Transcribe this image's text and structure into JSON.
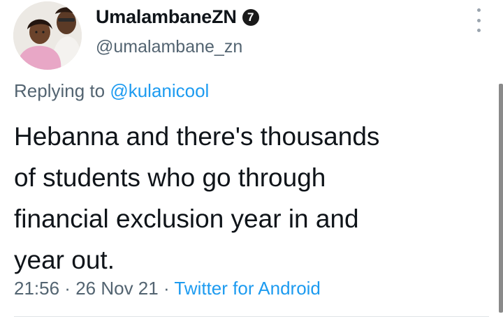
{
  "user": {
    "display_name": "UmalambaneZN",
    "badge": "7",
    "handle": "@umalambane_zn"
  },
  "reply": {
    "prefix": "Replying to ",
    "mention": "@kulanicool"
  },
  "tweet": {
    "text": "Hebanna and there's thousands\nof students who go through\nfinancial exclusion year in and\nyear out."
  },
  "meta": {
    "time": "21:56",
    "separator1": " · ",
    "date": "26 Nov 21",
    "separator2": " · ",
    "source": "Twitter for Android"
  },
  "icons": {
    "more": "more-vertical-icon"
  },
  "colors": {
    "link": "#1d9bf0",
    "secondary_text": "#536471",
    "primary_text": "#0f1419"
  }
}
